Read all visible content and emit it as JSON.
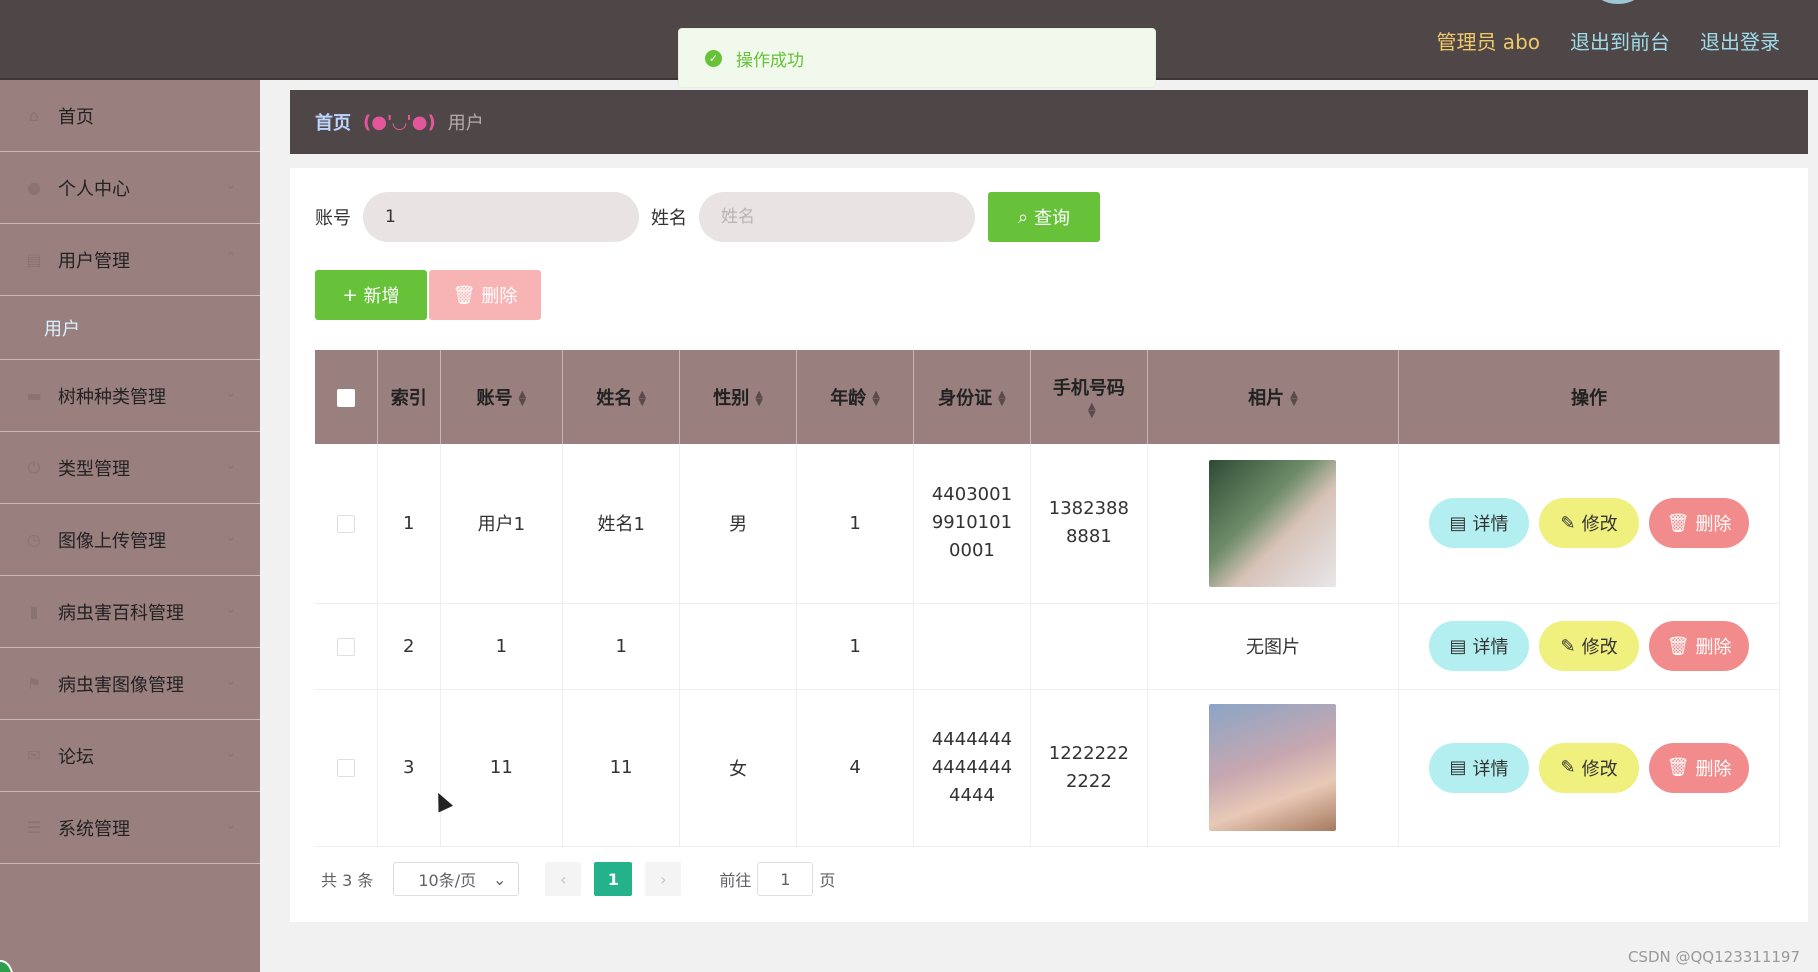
{
  "header": {
    "admin_label": "管理员 abo",
    "to_frontend": "退出到前台",
    "logout": "退出登录"
  },
  "toast": {
    "icon": "check-circle-icon",
    "message": "操作成功"
  },
  "sidebar": {
    "items": [
      {
        "label": "首页",
        "icon": "home-icon"
      },
      {
        "label": "个人中心",
        "icon": "user-icon"
      },
      {
        "label": "用户管理",
        "icon": "id-card-icon"
      },
      {
        "label": "用户",
        "submenu": true
      },
      {
        "label": "树种种类管理",
        "icon": "ticket-icon"
      },
      {
        "label": "类型管理",
        "icon": "power-icon"
      },
      {
        "label": "图像上传管理",
        "icon": "clock-icon"
      },
      {
        "label": "病虫害百科管理",
        "icon": "book-icon"
      },
      {
        "label": "病虫害图像管理",
        "icon": "flag-icon"
      },
      {
        "label": "论坛",
        "icon": "mail-icon"
      },
      {
        "label": "系统管理",
        "icon": "list-icon"
      }
    ]
  },
  "breadcrumb": {
    "home": "首页",
    "separator": "(●'◡'●)",
    "current": "用户"
  },
  "search": {
    "account_label": "账号",
    "account_value": "1",
    "name_label": "姓名",
    "name_placeholder": "姓名",
    "query_button": "查询"
  },
  "actions": {
    "add": "新增",
    "delete": "删除"
  },
  "table": {
    "headers": [
      "索引",
      "账号",
      "姓名",
      "性别",
      "年龄",
      "身份证",
      "手机号码",
      "相片",
      "操作"
    ],
    "rows": [
      {
        "index": "1",
        "account": "用户1",
        "name": "姓名1",
        "gender": "男",
        "age": "1",
        "id_card": "440300199101010001",
        "phone": "13823888881",
        "photo": "image"
      },
      {
        "index": "2",
        "account": "1",
        "name": "1",
        "gender": "",
        "age": "1",
        "id_card": "",
        "phone": "",
        "photo": "无图片"
      },
      {
        "index": "3",
        "account": "11",
        "name": "11",
        "gender": "女",
        "age": "4",
        "id_card": "444444444444444444",
        "phone": "12222222222",
        "photo": "image"
      }
    ],
    "row_actions": {
      "detail": "详情",
      "edit": "修改",
      "remove": "删除"
    }
  },
  "pagination": {
    "total": "共 3 条",
    "page_size": "10条/页",
    "current_page": "1",
    "goto_prefix": "前往",
    "goto_value": "1",
    "goto_suffix": "页"
  },
  "watermark": "CSDN @QQ123311197",
  "colors": {
    "header_bg": "#4f4647",
    "sidebar_bg": "#9a7f7f",
    "primary_green": "#67c23a",
    "page_active": "#23b28a"
  }
}
